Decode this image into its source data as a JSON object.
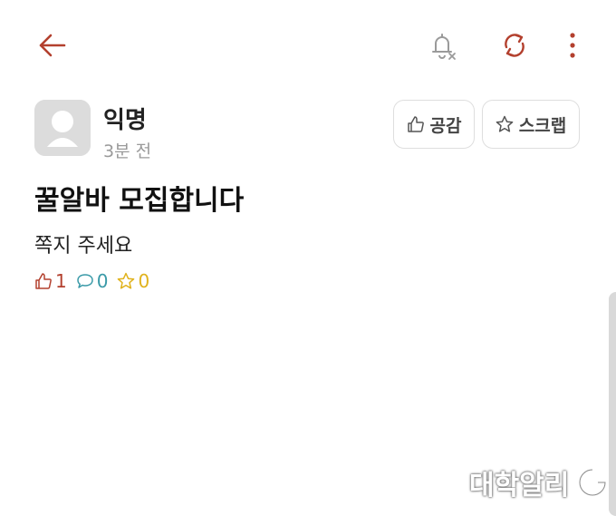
{
  "header": {
    "back_icon": "arrow-left-icon",
    "notification_icon": "bell-off-icon",
    "refresh_icon": "refresh-icon",
    "more_icon": "more-vertical-icon"
  },
  "post": {
    "author": "익명",
    "time": "3분 전",
    "like_button_label": "공감",
    "scrap_button_label": "스크랩",
    "title": "꿀알바 모집합니다",
    "body": "쪽지 주세요",
    "likes": "1",
    "comments": "0",
    "scraps": "0"
  },
  "colors": {
    "accent": "#b3402e",
    "comment": "#3a9aa8",
    "scrap": "#e0b21c"
  },
  "watermark": "대학알리"
}
